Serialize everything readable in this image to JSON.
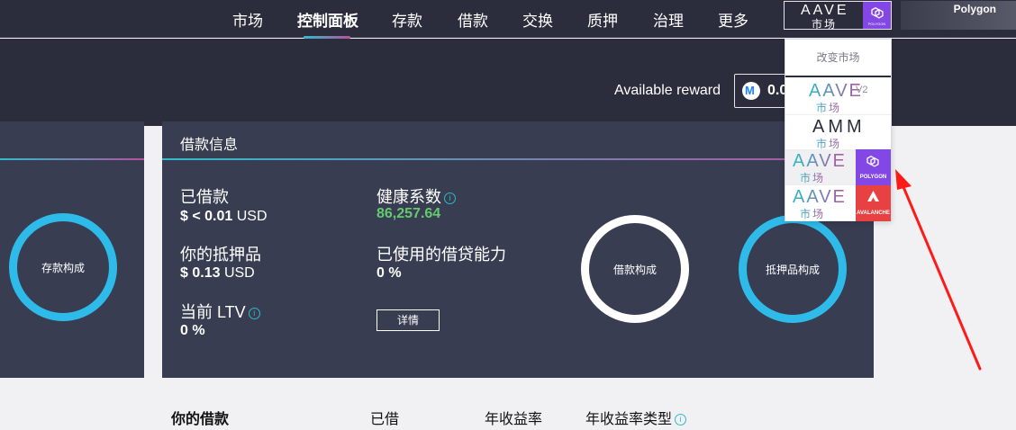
{
  "nav": {
    "items": [
      "市场",
      "控制面板",
      "存款",
      "借款",
      "交换",
      "质押",
      "治理",
      "更多"
    ],
    "active_index": 1
  },
  "market_selector": {
    "logo": "AAVE",
    "sub": "市场",
    "network_badge": "POLYGON"
  },
  "account": {
    "network": "Polygon"
  },
  "reward": {
    "label": "Available reward",
    "value": "0.0"
  },
  "deposit_card": {
    "ring_label": "存款构成"
  },
  "borrow_card": {
    "title": "借款信息",
    "borrowed_label": "已借款",
    "borrowed_value": "$ < 0.01",
    "borrowed_unit": "USD",
    "collateral_label": "你的抵押品",
    "collateral_value": "$ 0.13",
    "collateral_unit": "USD",
    "ltv_label": "当前 LTV",
    "ltv_value": "0 %",
    "health_label": "健康系数",
    "health_value": "86,257.64",
    "used_power_label": "已使用的借贷能力",
    "used_power_value": "0 %",
    "details_button": "详情",
    "borrow_ring_label": "借款构成",
    "collateral_ring_label": "抵押品构成"
  },
  "table": {
    "title": "你的借款",
    "columns": [
      "已借",
      "年收益率",
      "年收益率类型"
    ]
  },
  "dropdown": {
    "header": "改变市场",
    "items": [
      {
        "logo": "AAVE",
        "suffix": "V2",
        "sub": "市场",
        "badge": ""
      },
      {
        "logo": "AMM",
        "suffix": "",
        "sub": "市场",
        "badge": ""
      },
      {
        "logo": "AAVE",
        "suffix": "",
        "sub": "市场",
        "badge": "POLYGON"
      },
      {
        "logo": "AAVE",
        "suffix": "",
        "sub": "市场",
        "badge": "AVALANCHE"
      }
    ]
  },
  "colors": {
    "nav_bg": "#2b2d3c",
    "card_bg": "#383d51",
    "ring_blue": "#2ebbe9",
    "health_green": "#65c970",
    "polygon": "#8247e5",
    "avalanche": "#e84142",
    "arrow": "#ff1a1a"
  },
  "icons": [
    "polygon-icon",
    "avalanche-icon",
    "info-icon",
    "reward-token-icon"
  ]
}
